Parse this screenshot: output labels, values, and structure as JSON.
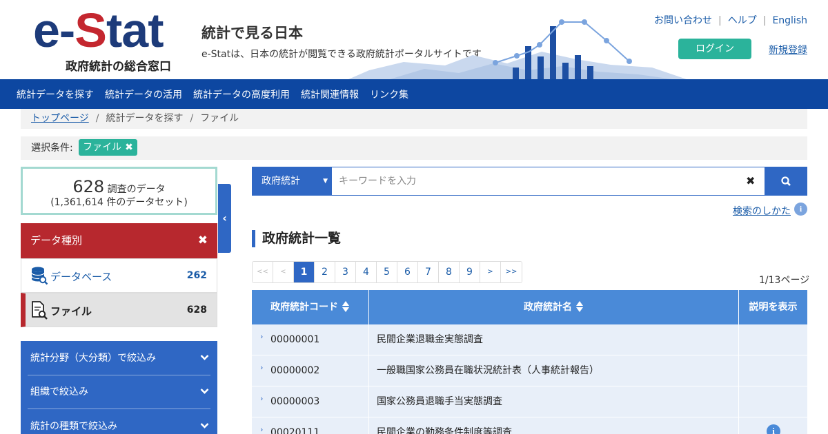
{
  "header": {
    "logo_text_dark_1": "e-",
    "logo_text_red": "S",
    "logo_text_dark_2": "tat",
    "logo_sub": "政府統計の総合窓口",
    "title": "統計で見る日本",
    "description": "e-Statは、日本の統計が閲覧できる政府統計ポータルサイトです",
    "links": {
      "contact": "お問い合わせ",
      "help": "ヘルプ",
      "english": "English"
    },
    "login": "ログイン",
    "register": "新規登録"
  },
  "nav": {
    "items": [
      "統計データを探す",
      "統計データの活用",
      "統計データの高度利用",
      "統計関連情報",
      "リンク集"
    ]
  },
  "breadcrumb": {
    "home": "トップページ",
    "item2": "統計データを探す",
    "item3": "ファイル"
  },
  "conditions": {
    "label": "選択条件:",
    "chip": "ファイル"
  },
  "summary": {
    "count": "628",
    "count_label": "調査のデータ",
    "dataset_line": "(1,361,614 件のデータセット)"
  },
  "data_type": {
    "heading": "データ種別",
    "database": {
      "label": "データベース",
      "count": "262"
    },
    "file": {
      "label": "ファイル",
      "count": "628"
    }
  },
  "filters": [
    "統計分野（大分類）で絞込み",
    "組織で絞込み",
    "統計の種類で絞込み"
  ],
  "search": {
    "select_value": "政府統計",
    "placeholder": "キーワードを入力",
    "howto": "検索のしかた"
  },
  "section_title": "政府統計一覧",
  "pagination": {
    "first": "<<",
    "prev": "<",
    "pages": [
      "1",
      "2",
      "3",
      "4",
      "5",
      "6",
      "7",
      "8",
      "9"
    ],
    "next": ">",
    "last": ">>",
    "current": "1",
    "page_info": "1/13ページ"
  },
  "table": {
    "headers": {
      "code": "政府統計コード",
      "name": "政府統計名",
      "desc": "説明を表示"
    },
    "rows": [
      {
        "code": "00000001",
        "name": "民間企業退職金実態調査",
        "has_info": false
      },
      {
        "code": "00000002",
        "name": "一般職国家公務員在職状況統計表（人事統計報告）",
        "has_info": false
      },
      {
        "code": "00000003",
        "name": "国家公務員退職手当実態調査",
        "has_info": false
      },
      {
        "code": "00020111",
        "name": "民間企業の勤務条件制度等調査",
        "has_info": true
      }
    ]
  },
  "colors": {
    "nav_bg": "#0d47a1",
    "accent_teal": "#2bb39b",
    "accent_red": "#b7282e",
    "panel_blue": "#2f67c4",
    "table_header": "#4a8ad8",
    "row_bg": "#e8eff9"
  },
  "icons": {
    "database": "database-search-icon",
    "file": "file-search-icon",
    "search": "magnifier-icon",
    "clear": "close-icon",
    "collapse": "chevron-left-icon",
    "expand": "chevron-down-icon",
    "info": "info-icon"
  }
}
